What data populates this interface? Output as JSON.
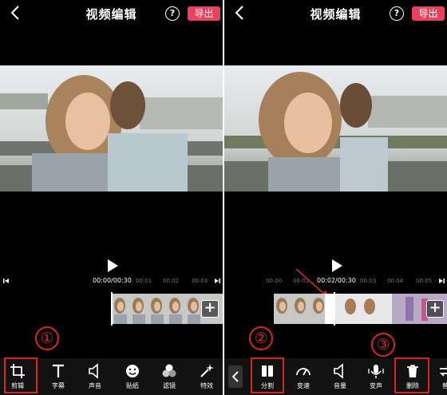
{
  "left": {
    "header": {
      "title": "视频编辑",
      "help": "?",
      "export": "导出"
    },
    "time": {
      "current": "00:00/00:30",
      "ticks": [
        "00:01",
        "00:02",
        "00:03"
      ]
    },
    "tools": [
      {
        "label": "剪辑",
        "icon": "crop-icon"
      },
      {
        "label": "字幕",
        "icon": "text-icon"
      },
      {
        "label": "声音",
        "icon": "speaker-icon"
      },
      {
        "label": "贴纸",
        "icon": "smiley-icon"
      },
      {
        "label": "滤镜",
        "icon": "filter-icon"
      },
      {
        "label": "特效",
        "icon": "magic-icon"
      }
    ],
    "step": "①"
  },
  "right": {
    "header": {
      "title": "视频编辑",
      "help": "?",
      "export": "导出"
    },
    "time": {
      "current": "00:02/00:30",
      "ticks": [
        "00:00",
        "00:01",
        "00:03",
        "00:04",
        "00:05"
      ]
    },
    "tools": [
      {
        "label": "分割",
        "icon": "split-icon"
      },
      {
        "label": "变速",
        "icon": "speed-icon"
      },
      {
        "label": "音量",
        "icon": "speaker-icon"
      },
      {
        "label": "变声",
        "icon": "voice-icon"
      },
      {
        "label": "删除",
        "icon": "trash-icon"
      },
      {
        "label": "替",
        "icon": "replace-icon"
      }
    ],
    "steps": [
      "②",
      "③"
    ]
  },
  "colors": {
    "accent": "#e8415e",
    "highlight": "#d8261f",
    "background": "#000000"
  }
}
